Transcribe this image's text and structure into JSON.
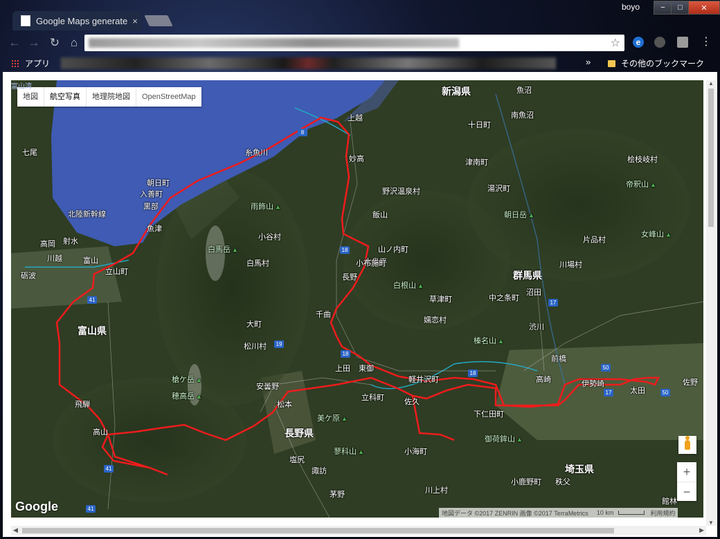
{
  "browser": {
    "tab_title": "Google Maps generate",
    "tab_close": "×",
    "user_name": "boyo",
    "win_min": "−",
    "win_max": "□",
    "win_close": "✕",
    "bookmarks": {
      "apps_label": "アプリ",
      "more": "»",
      "other_bookmarks": "その他のブックマーク"
    }
  },
  "map": {
    "map_types": [
      "地図",
      "航空写真",
      "地理院地図",
      "OpenStreetMap"
    ],
    "google_logo": "Google",
    "attribution": {
      "data": "地図データ ©2017 ZENRIN 画像 ©2017 TerraMetrics",
      "scale": "10 km",
      "terms": "利用規約"
    },
    "zoom_in": "+",
    "zoom_out": "−",
    "prefectures": [
      "新潟県",
      "富山県",
      "長野県",
      "群馬県",
      "埼玉県"
    ],
    "places": [
      "魚沼",
      "南魚沼",
      "十日町",
      "津南町",
      "湯沢町",
      "上越",
      "妙高",
      "糸魚川",
      "朝日町",
      "入善町",
      "黒部",
      "魚津",
      "七尾",
      "高岡",
      "射水",
      "富山",
      "立山町",
      "砺波",
      "飯山",
      "野沢温泉村",
      "山ノ内町",
      "木島平",
      "小谷村",
      "白馬村",
      "長野",
      "小布施町",
      "千曲",
      "大町",
      "松川村",
      "上田",
      "東御",
      "軽井沢町",
      "安曇野",
      "松本",
      "立科町",
      "佐久",
      "下仁田町",
      "高崎",
      "伊勢崎",
      "太田",
      "前橋",
      "渋川",
      "沼田",
      "川場村",
      "中之条町",
      "草津町",
      "嬬恋村",
      "片品村",
      "桧枝岐村",
      "飛騨",
      "高山",
      "塩尻",
      "諏訪",
      "茅野",
      "小海町",
      "川上村",
      "小鹿野町",
      "秩父",
      "佐野",
      "館林",
      "川越",
      "北陸新幹線",
      "富山湾"
    ],
    "mountains": [
      "帝釈山",
      "女峰山",
      "朝日岳",
      "雨飾山",
      "白馬岳",
      "白根山",
      "榛名山",
      "槍ケ岳",
      "穂高岳",
      "美ケ原",
      "蓼科山",
      "御荷鉾山"
    ],
    "route_shields": [
      "8",
      "18",
      "18",
      "41",
      "19",
      "18",
      "17",
      "50",
      "17",
      "50",
      "41",
      "41"
    ]
  }
}
